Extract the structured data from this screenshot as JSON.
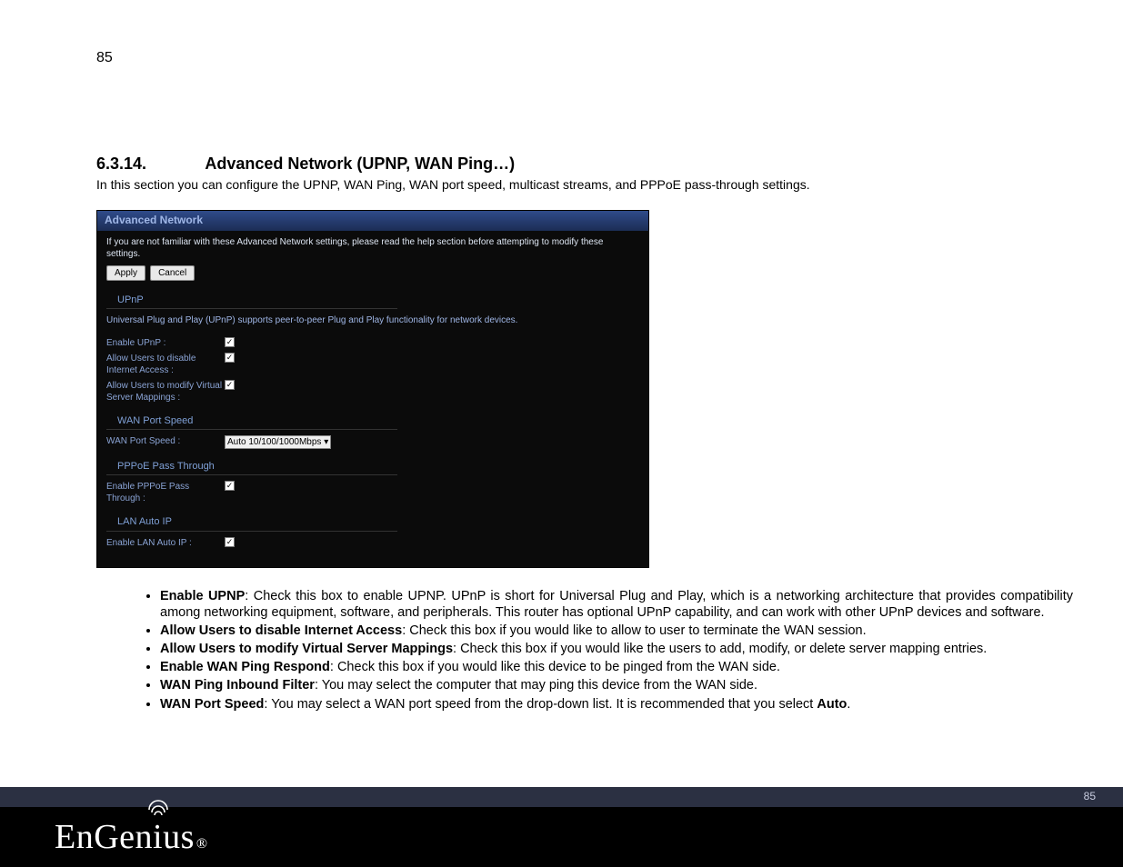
{
  "page": {
    "top_number": "85",
    "footer_number": "85"
  },
  "section": {
    "number": "6.3.14.",
    "title": "Advanced Network (UPNP, WAN Ping…)",
    "intro": "In this section you can configure the UPNP, WAN Ping, WAN port speed, multicast streams, and PPPoE pass-through settings."
  },
  "panel": {
    "title": "Advanced Network",
    "help": "If you are not familiar with these Advanced Network settings, please read the help section before attempting to modify these settings.",
    "apply": "Apply",
    "cancel": "Cancel",
    "upnp": {
      "header": "UPnP",
      "desc": "Universal Plug and Play (UPnP) supports peer-to-peer Plug and Play functionality for network devices.",
      "enable_label": "Enable UPnP :",
      "allow_disable_label": "Allow Users to disable Internet Access :",
      "allow_modify_label": "Allow Users to modify Virtual Server Mappings :"
    },
    "wanport": {
      "header": "WAN Port Speed",
      "label": "WAN Port Speed :",
      "value": "Auto 10/100/1000Mbps"
    },
    "pppoe": {
      "header": "PPPoE Pass Through",
      "label": "Enable PPPoE Pass Through :"
    },
    "lanauto": {
      "header": "LAN Auto IP",
      "label": "Enable LAN Auto IP :"
    },
    "check_glyph": "✓"
  },
  "bullets": {
    "b1_bold": "Enable UPNP",
    "b1_text": ": Check this box to enable UPNP.  UPnP is short for Universal Plug and Play, which is a networking architecture that provides compatibility among networking equipment, software, and peripherals. This router has optional UPnP capability, and can work with other UPnP devices and software.",
    "b2_bold": "Allow Users to disable Internet Access",
    "b2_text": ": Check this box if you would like to allow to user to terminate the WAN session.",
    "b3_bold": "Allow Users to modify Virtual Server Mappings",
    "b3_text": ": Check this box if you would like the users to add, modify, or delete server mapping entries.",
    "b4_bold": "Enable WAN Ping Respond",
    "b4_text": ": Check this box if you would like this device to be pinged from the WAN side.",
    "b5_bold": "WAN Ping Inbound Filter",
    "b5_text": ": You may select the computer that may ping this device from the WAN side.",
    "b6_bold": "WAN Port Speed",
    "b6_text_a": ": You may select a WAN port speed from the drop-down list. It is recommended that you select ",
    "b6_text_b": "Auto",
    "b6_text_c": "."
  },
  "logo": {
    "text_a": "EnGen",
    "text_b": "us",
    "reg": "®"
  }
}
